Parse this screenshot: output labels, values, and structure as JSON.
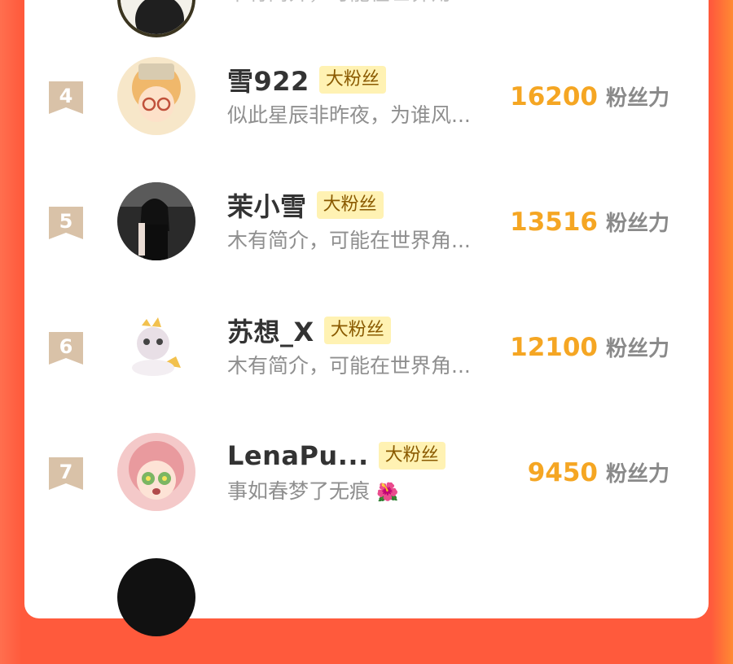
{
  "unit_label": "粉丝力",
  "tag_label": "大粉丝",
  "rows": [
    {
      "rank": "4",
      "name": "雪922",
      "bio": "似此星辰非昨夜，为谁风...",
      "score": "16200"
    },
    {
      "rank": "5",
      "name": "茉小雪",
      "bio": "木有简介，可能在世界角...",
      "score": "13516"
    },
    {
      "rank": "6",
      "name": "苏想_X",
      "bio": "木有简介，可能在世界角...",
      "score": "12100"
    },
    {
      "rank": "7",
      "name": "LenaPu...",
      "bio": "事如春梦了无痕",
      "score": "9450"
    }
  ],
  "top_partial_bio": "木有简介，可能在世界角",
  "colors": {
    "accent_score": "#f5a623",
    "tag_bg": "#fff2b3",
    "badge": "#d9c2a8"
  },
  "icons": [
    "rank-ribbon-icon",
    "flower-icon"
  ]
}
